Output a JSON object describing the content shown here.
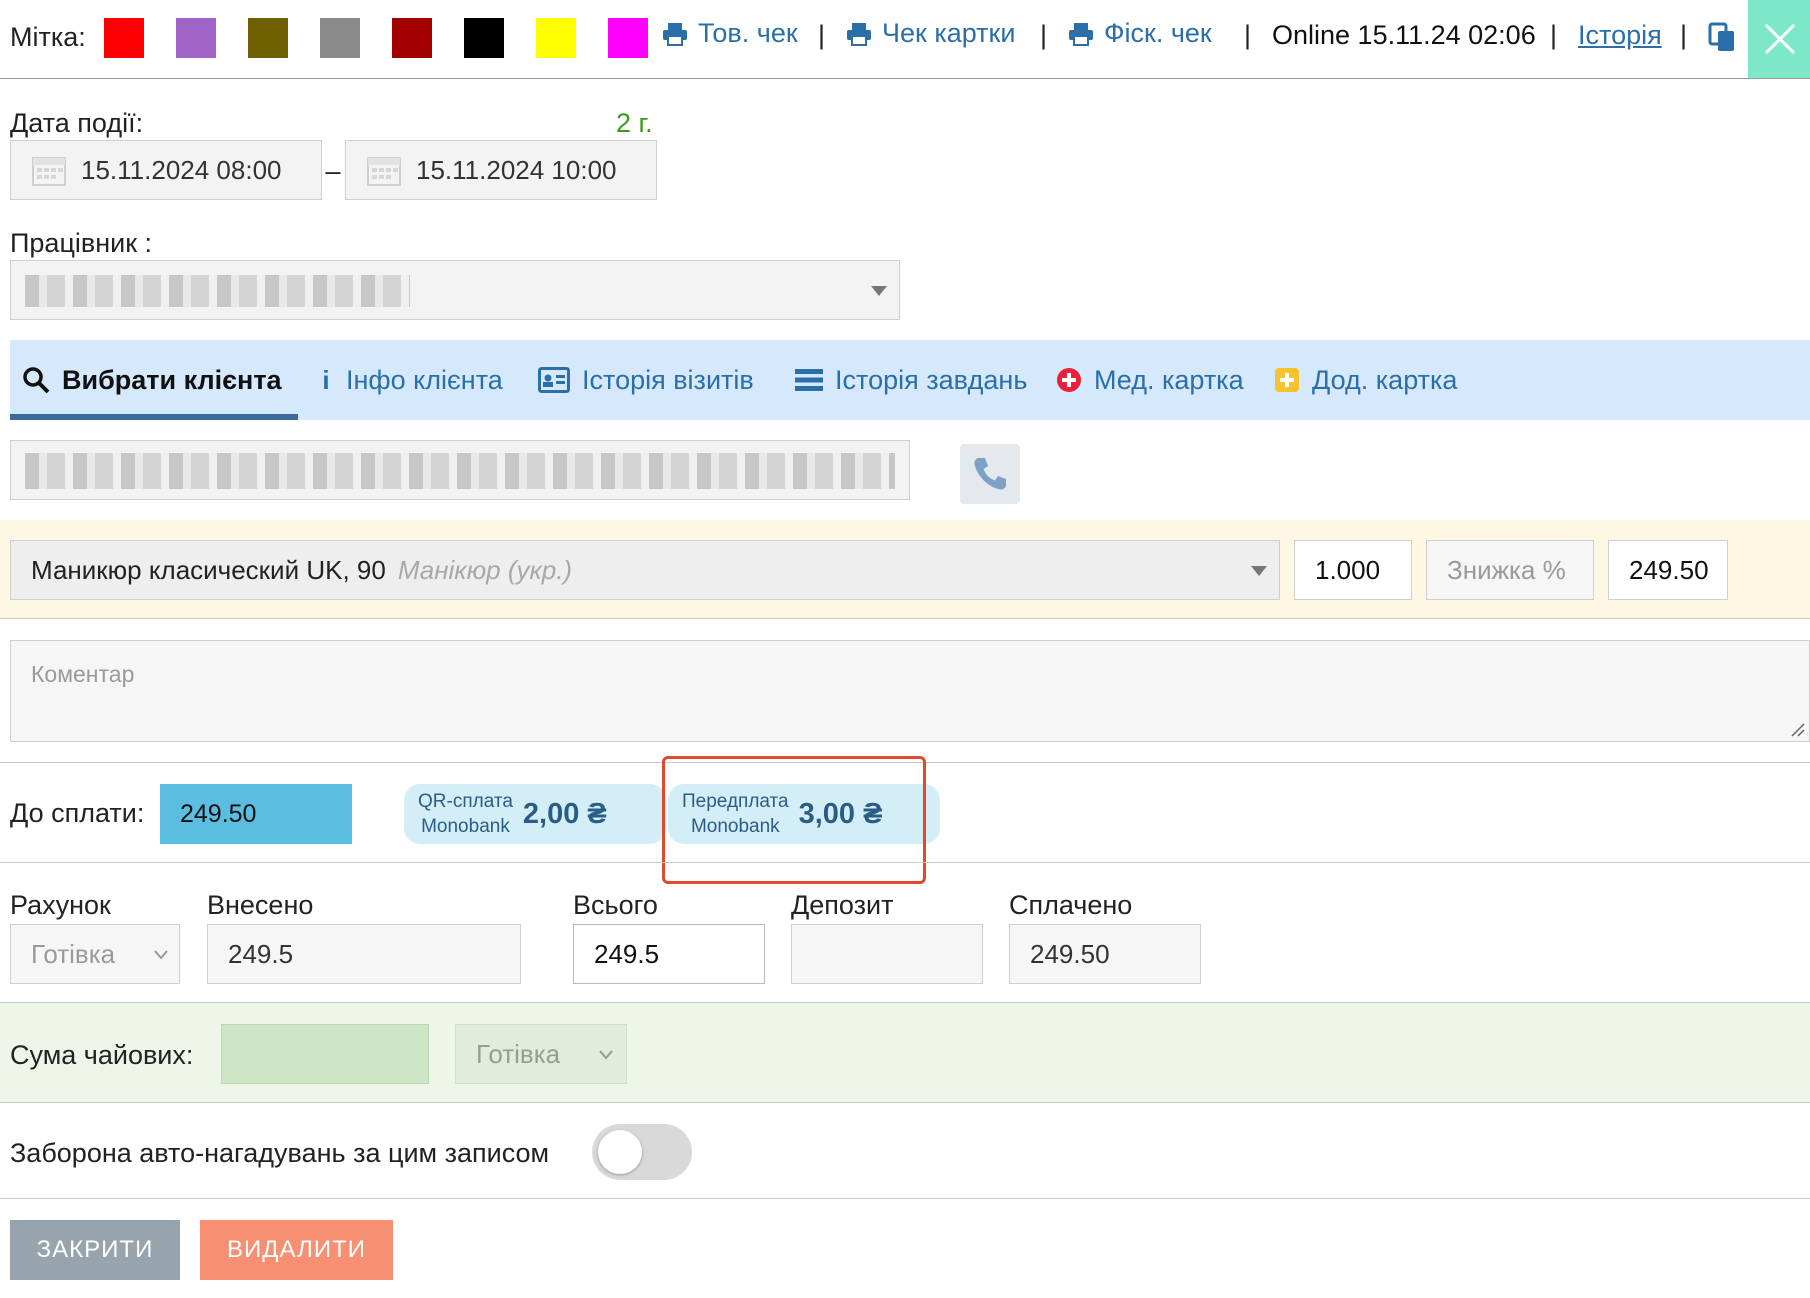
{
  "header": {
    "label": "Мітка:",
    "colors": [
      "#ff0000",
      "#a063c8",
      "#6e5f00",
      "#8a8a8a",
      "#a30000",
      "#000000",
      "#ffff00",
      "#ff00ff"
    ],
    "links": {
      "goods_receipt": "Тов. чек",
      "card_receipt": "Чек картки",
      "fiscal_receipt": "Фіск. чек"
    },
    "separator": "|",
    "status": "Online 15.11.24 02:06",
    "history": "Історія",
    "close_accent": "#7fe8c8"
  },
  "event": {
    "label": "Дата події:",
    "duration": "2 г.",
    "start": "15.11.2024 08:00",
    "dash": "–",
    "end": "15.11.2024 10:00"
  },
  "worker": {
    "label": "Працівник :"
  },
  "tabs": [
    {
      "label": "Вибрати клієнта"
    },
    {
      "label": "Інфо клієнта"
    },
    {
      "label": "Історія візитів"
    },
    {
      "label": "Історія завдань"
    },
    {
      "label": "Мед. картка"
    },
    {
      "label": "Дод. картка"
    }
  ],
  "service": {
    "name": "Маникюр класический UK, 90",
    "subtitle": "Манікюр (укр.)",
    "quantity": "1.000",
    "discount_placeholder": "Знижка %",
    "price": "249.50"
  },
  "comment": {
    "placeholder": "Коментар"
  },
  "payment": {
    "due_label": "До сплати:",
    "due_value": "249.50",
    "qr_line1": "QR-сплата",
    "qr_line2": "Monobank",
    "qr_amount": "2,00 ₴",
    "pre_line1": "Передплата",
    "pre_line2": "Monobank",
    "pre_amount": "3,00 ₴"
  },
  "totals": {
    "account_label": "Рахунок",
    "account_value": "Готівка",
    "deposited_label": "Внесено",
    "deposited_value": "249.5",
    "total_label": "Всього",
    "total_value": "249.5",
    "deposit_label": "Депозит",
    "deposit_value": "",
    "paid_label": "Сплачено",
    "paid_value": "249.50"
  },
  "tips": {
    "label": "Сума чайових:",
    "method": "Готівка"
  },
  "reminder": {
    "label": "Заборона авто-нагадувань за цим записом",
    "enabled": false
  },
  "actions": {
    "close": "ЗАКРИТИ",
    "delete": "ВИДАЛИТИ"
  }
}
